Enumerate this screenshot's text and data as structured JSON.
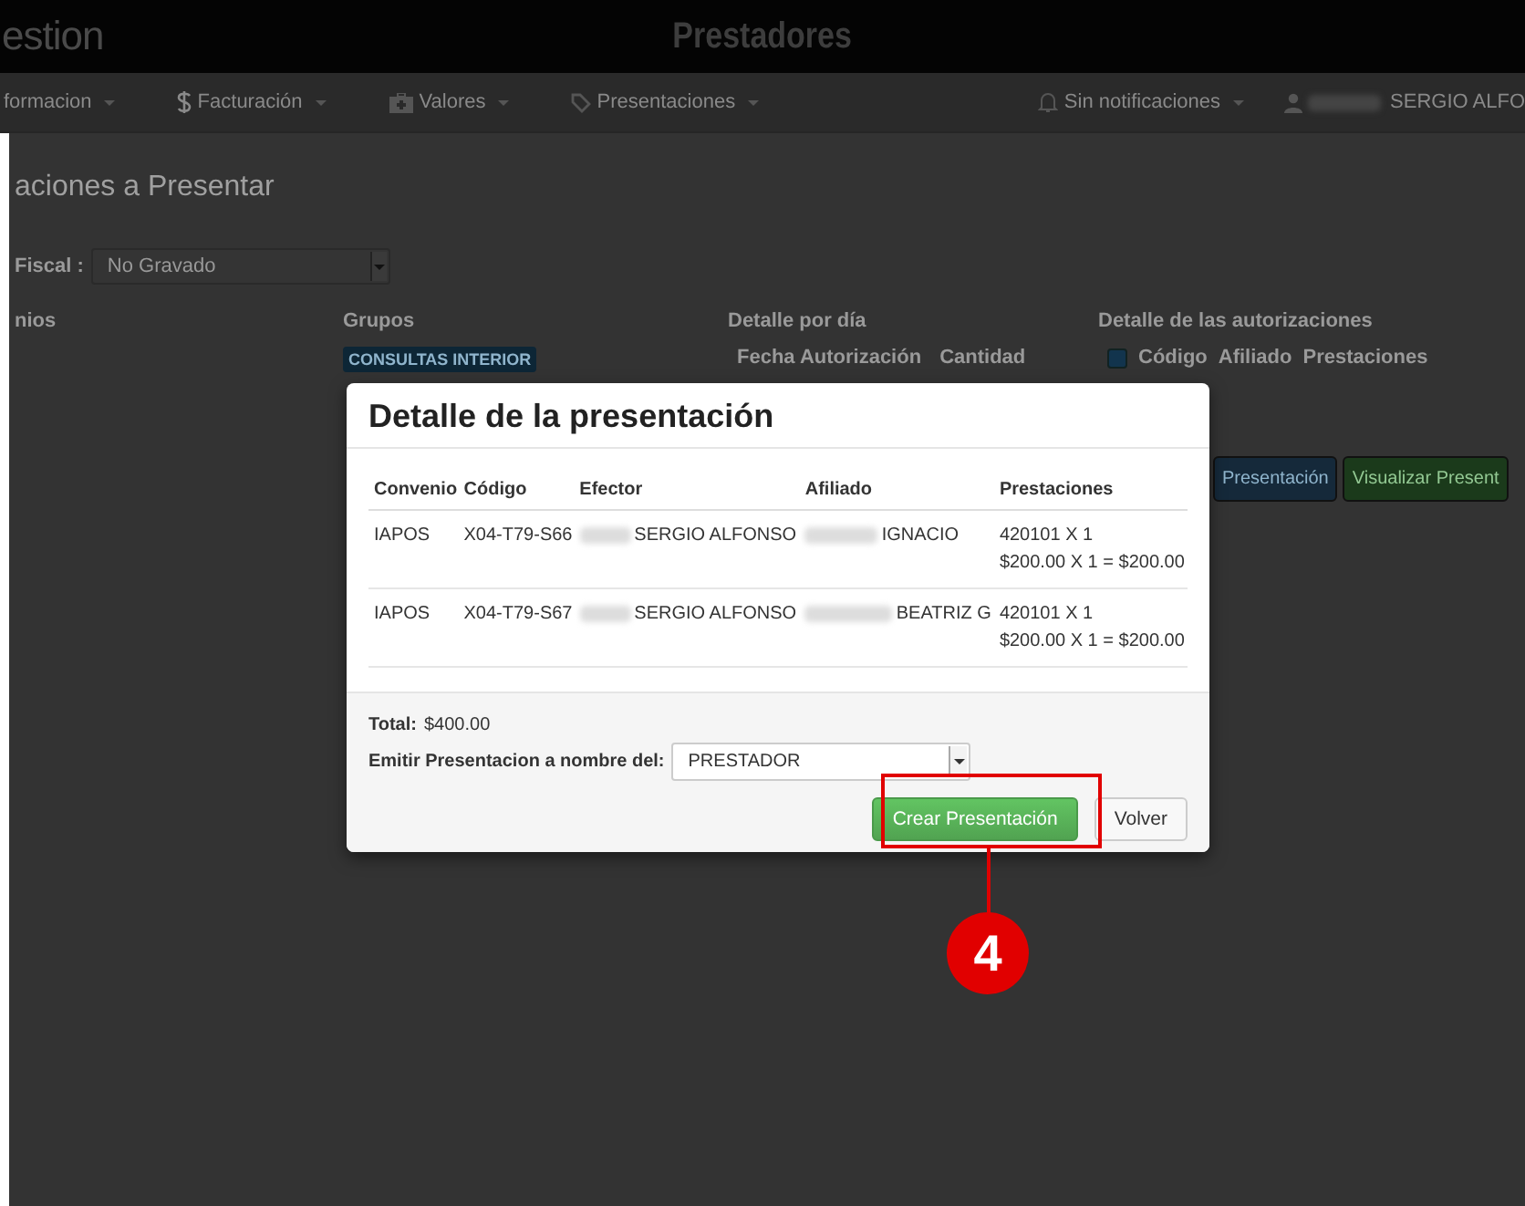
{
  "topbar": {
    "logo": "estion",
    "title": "Prestadores"
  },
  "nav": {
    "items": [
      {
        "label": "formacion"
      },
      {
        "label": "Facturación"
      },
      {
        "label": "Valores"
      },
      {
        "label": "Presentaciones"
      }
    ],
    "notifications": "Sin notificaciones",
    "user": "SERGIO ALFO"
  },
  "page": {
    "heading": "aciones a Presentar",
    "fiscal_label": "Fiscal :",
    "fiscal_value": "No Gravado",
    "columns": [
      {
        "kind": "text",
        "title": "nios"
      },
      {
        "kind": "badge",
        "title": "Grupos",
        "badge": "CONSULTAS INTERIOR"
      },
      {
        "kind": "headers",
        "title": "Detalle por día",
        "headers": [
          "Fecha Autorización",
          "Cantidad"
        ]
      },
      {
        "kind": "check",
        "title": "Detalle de las autorizaciones",
        "checked": true,
        "headers": [
          "Código",
          "Afiliado",
          "Prestaciones"
        ]
      }
    ],
    "buttons": [
      {
        "label": "Presentación",
        "kind": "primary"
      },
      {
        "label": "Visualizar Present",
        "kind": "success"
      }
    ]
  },
  "modal": {
    "title": "Detalle de la presentación",
    "columns": [
      "Convenio",
      "Código",
      "Efector",
      "Afiliado",
      "Prestaciones"
    ],
    "rows": [
      {
        "convenio": "IAPOS",
        "codigo": "X04-T79-S66",
        "efector": "SERGIO ALFONSO",
        "afiliado": "IGNACIO",
        "prestacion": "420101 X 1",
        "importe": "$200.00 X 1 = $200.00"
      },
      {
        "convenio": "IAPOS",
        "codigo": "X04-T79-S67",
        "efector": "SERGIO ALFONSO",
        "afiliado": "BEATRIZ G",
        "prestacion": "420101 X 1",
        "importe": "$200.00 X 1 = $200.00"
      }
    ],
    "total_label": "Total:",
    "total_value": "$400.00",
    "emit_label": "Emitir Presentacion a nombre del:",
    "emit_value": "PRESTADOR",
    "buttons": [
      {
        "label": "Crear Presentación",
        "kind": "success"
      },
      {
        "label": "Volver",
        "kind": "default"
      }
    ]
  },
  "callout": {
    "number": "4"
  }
}
